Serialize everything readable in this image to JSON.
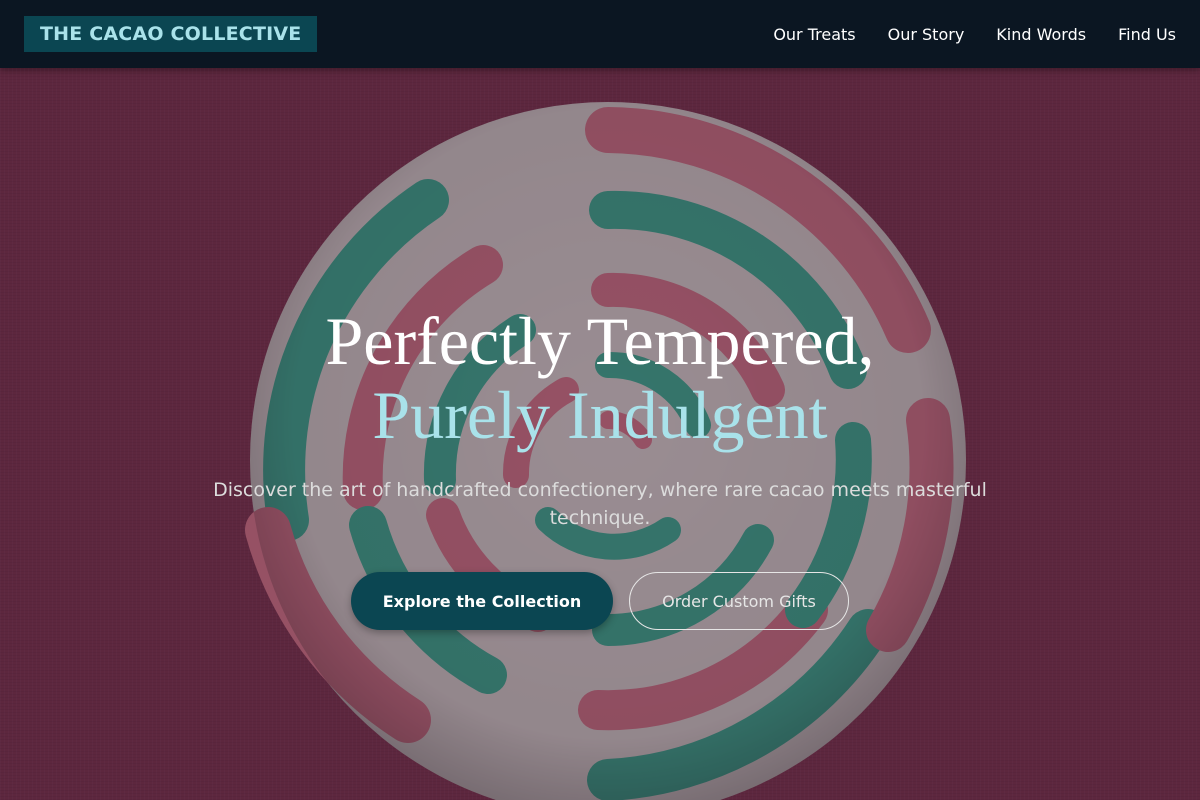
{
  "nav": {
    "brand": "THE CACAO COLLECTIVE",
    "links": [
      "Our Treats",
      "Our Story",
      "Kind Words",
      "Find Us"
    ]
  },
  "hero": {
    "title_line1": "Perfectly Tempered,",
    "title_line2": "Purely Indulgent",
    "subtitle": "Discover the art of handcrafted confectionery, where rare cacao meets masterful technique.",
    "primary_cta": "Explore the Collection",
    "secondary_cta": "Order Custom Gifts",
    "background_image": "swirl-lollipop"
  },
  "colors": {
    "nav_bg": "#0b1622",
    "brand_bg": "#0b4652",
    "brand_text": "#a9e2ea",
    "accent": "#a9e2ea",
    "primary_button": "#0b4652",
    "background": "#83324f"
  }
}
